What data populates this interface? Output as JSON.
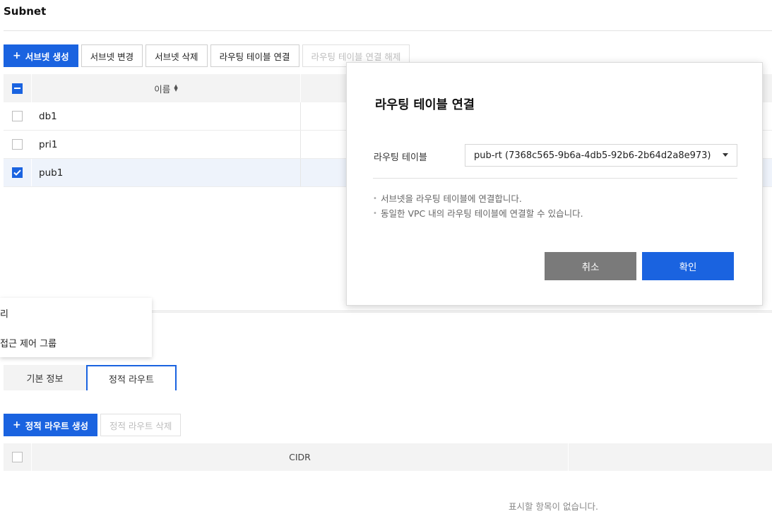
{
  "page": {
    "title": "Subnet"
  },
  "toolbar": {
    "create_label": "서브넷 생성",
    "edit_label": "서브넷 변경",
    "delete_label": "서브넷 삭제",
    "associate_label": "라우팅 테이블 연결",
    "disassociate_label": "라우팅 테이블 연결 해제"
  },
  "subnet_table": {
    "name_header": "이름",
    "rows": [
      {
        "name": "db1",
        "checked": false
      },
      {
        "name": "pri1",
        "checked": false
      },
      {
        "name": "pub1",
        "checked": true
      }
    ]
  },
  "dropdown_menu": {
    "items": [
      "리",
      "접근 제어 그룹"
    ]
  },
  "tabs": [
    {
      "label": "기본 정보",
      "active": false
    },
    {
      "label": "정적 라우트",
      "active": true
    }
  ],
  "routes_toolbar": {
    "create_label": "정적 라우트 생성",
    "delete_label": "정적 라우트 삭제"
  },
  "routes_table": {
    "cidr_header": "CIDR",
    "empty_message": "표시할 항목이 없습니다."
  },
  "modal": {
    "title": "라우팅 테이블 연결",
    "field_label": "라우팅 테이블",
    "selected_value": "pub-rt (7368c565-9b6a-4db5-92b6-2b64d2a8e973)",
    "notes": [
      "서브넷을 라우팅 테이블에 연결합니다.",
      "동일한 VPC 내의 라우팅 테이블에 연결할 수 있습니다."
    ],
    "cancel_label": "취소",
    "confirm_label": "확인"
  },
  "colors": {
    "accent": "#1a63e0",
    "cancel": "#7a7a7a"
  }
}
